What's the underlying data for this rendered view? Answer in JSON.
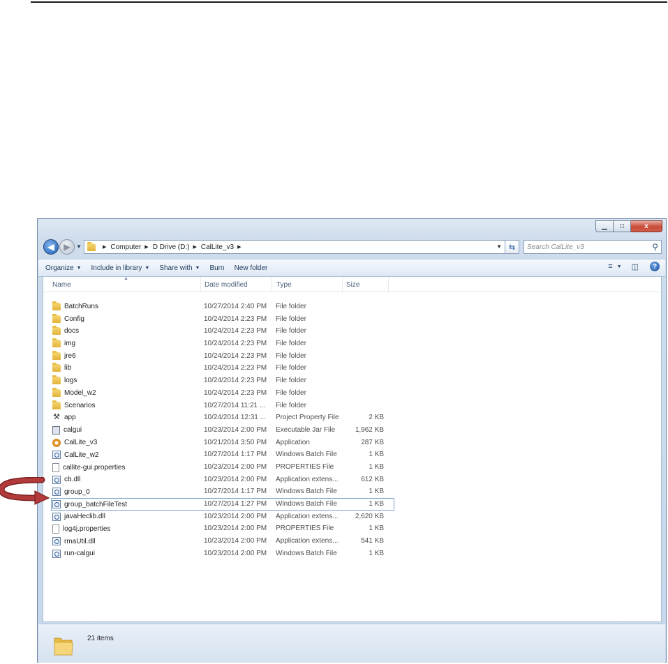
{
  "window": {
    "caption_buttons": [
      {
        "name": "minimize-button",
        "glyph": "▁"
      },
      {
        "name": "maximize-button",
        "glyph": "□"
      },
      {
        "name": "close-button",
        "glyph": "x"
      }
    ]
  },
  "address": {
    "breadcrumbs": [
      "Computer",
      "D Drive (D:)",
      "CalLite_v3"
    ],
    "search_placeholder": "Search CalLite_v3"
  },
  "toolbar": {
    "organize": "Organize",
    "include_in_library": "Include in library",
    "share_with": "Share with",
    "burn": "Burn",
    "new_folder": "New folder"
  },
  "columns": {
    "name": "Name",
    "date_modified": "Date modified",
    "type": "Type",
    "size": "Size"
  },
  "files": [
    {
      "name": "BatchRuns",
      "date": "10/27/2014 2:40 PM",
      "type": "File folder",
      "size": "",
      "icon": "folder-icon"
    },
    {
      "name": "Config",
      "date": "10/24/2014 2:23 PM",
      "type": "File folder",
      "size": "",
      "icon": "folder-icon"
    },
    {
      "name": "docs",
      "date": "10/24/2014 2:23 PM",
      "type": "File folder",
      "size": "",
      "icon": "folder-icon"
    },
    {
      "name": "img",
      "date": "10/24/2014 2:23 PM",
      "type": "File folder",
      "size": "",
      "icon": "folder-icon"
    },
    {
      "name": "jre6",
      "date": "10/24/2014 2:23 PM",
      "type": "File folder",
      "size": "",
      "icon": "folder-icon"
    },
    {
      "name": "lib",
      "date": "10/24/2014 2:23 PM",
      "type": "File folder",
      "size": "",
      "icon": "folder-icon"
    },
    {
      "name": "logs",
      "date": "10/24/2014 2:23 PM",
      "type": "File folder",
      "size": "",
      "icon": "folder-icon"
    },
    {
      "name": "Model_w2",
      "date": "10/24/2014 2:23 PM",
      "type": "File folder",
      "size": "",
      "icon": "folder-icon"
    },
    {
      "name": "Scenarios",
      "date": "10/27/2014 11:21 ...",
      "type": "File folder",
      "size": "",
      "icon": "folder-icon"
    },
    {
      "name": "app",
      "date": "10/24/2014 12:31 ...",
      "type": "Project Property File",
      "size": "2 KB",
      "icon": "wrench-icon"
    },
    {
      "name": "calgui",
      "date": "10/23/2014 2:00 PM",
      "type": "Executable Jar File",
      "size": "1,962 KB",
      "icon": "jar-file-icon"
    },
    {
      "name": "CalLite_v3",
      "date": "10/21/2014 3:50 PM",
      "type": "Application",
      "size": "287 KB",
      "icon": "application-icon"
    },
    {
      "name": "CalLite_w2",
      "date": "10/27/2014 1:17 PM",
      "type": "Windows Batch File",
      "size": "1 KB",
      "icon": "batch-file-icon"
    },
    {
      "name": "callite-gui.properties",
      "date": "10/23/2014 2:00 PM",
      "type": "PROPERTIES File",
      "size": "1 KB",
      "icon": "document-icon"
    },
    {
      "name": "cb.dll",
      "date": "10/23/2014 2:00 PM",
      "type": "Application extens...",
      "size": "612 KB",
      "icon": "dll-file-icon"
    },
    {
      "name": "group_0",
      "date": "10/27/2014 1:17 PM",
      "type": "Windows Batch File",
      "size": "1 KB",
      "icon": "batch-file-icon"
    },
    {
      "name": "group_batchFileTest",
      "date": "10/27/2014 1:27 PM",
      "type": "Windows Batch File",
      "size": "1 KB",
      "icon": "batch-file-icon",
      "selected": true
    },
    {
      "name": "javaHeclib.dll",
      "date": "10/23/2014 2:00 PM",
      "type": "Application extens...",
      "size": "2,620 KB",
      "icon": "dll-file-icon"
    },
    {
      "name": "log4j.properties",
      "date": "10/23/2014 2:00 PM",
      "type": "PROPERTIES File",
      "size": "1 KB",
      "icon": "document-icon"
    },
    {
      "name": "rmaUtil.dll",
      "date": "10/23/2014 2:00 PM",
      "type": "Application extens...",
      "size": "541 KB",
      "icon": "dll-file-icon"
    },
    {
      "name": "run-calgui",
      "date": "10/23/2014 2:00 PM",
      "type": "Windows Batch File",
      "size": "1 KB",
      "icon": "batch-file-icon"
    }
  ],
  "status": {
    "item_count": "21 items"
  },
  "colors": {
    "accent": "#1f5fb4",
    "annotation_arrow": "#b23a3a",
    "selection_border": "#7da2ce"
  }
}
